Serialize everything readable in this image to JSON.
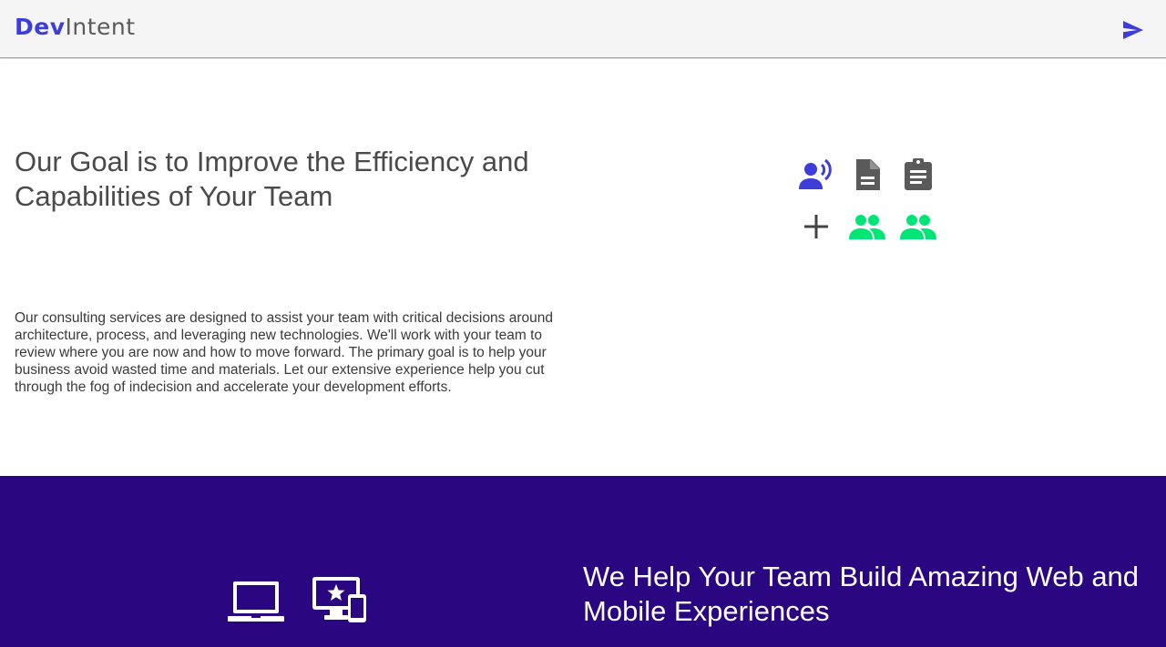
{
  "header": {
    "logo_part1": "Dev",
    "logo_part2": "Intent",
    "send_icon": "send-icon"
  },
  "goal_section": {
    "title": "Our Goal is to Improve the Efficiency and Capabilities of Your Team",
    "description": "Our consulting services are designed to assist your team with critical decisions around architecture, process, and leveraging new technologies. We'll work with your team to review where you are now and how to move forward. The primary goal is to help your business avoid wasted time and materials. Let our extensive experience help you cut through the fog of indecision and accelerate your development efforts.",
    "icons": [
      "record-voice-icon",
      "description-icon",
      "assignment-icon",
      "add-icon",
      "people-icon",
      "people-icon"
    ]
  },
  "build_section": {
    "title": "We Help Your Team Build Amazing Web and Mobile Experiences",
    "icons": [
      "laptop-icon",
      "devices-icon"
    ]
  },
  "colors": {
    "brand_blue": "#3d3dd9",
    "icon_gray": "#5a5a5a",
    "icon_green": "#00e676",
    "banner_purple": "#2a0680",
    "toolbar_bg": "#f5f5f5"
  }
}
